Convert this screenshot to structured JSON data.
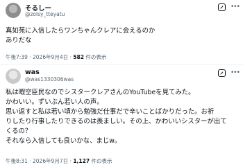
{
  "post1": {
    "display_name": "そるしー",
    "handle": "@zolsy_tteyatu",
    "text_lines": [
      "真如苑に入信したらワンちゃんクレアに会えるのか",
      "ありだな"
    ],
    "time": "午後7:39",
    "date": "2026年9月4日",
    "views_count": "582",
    "views_label": "件の表示",
    "icons": [
      "grok-icon",
      "more-icon"
    ]
  },
  "post2": {
    "display_name": "was",
    "handle": "@was1330306was",
    "text_lines": [
      "私は暇空臣民なのでシスタークレアさんのYouTubeを見てみた。",
      "かわいい。ずいぶん若い人の声。",
      "思い返すと私は若い頃から勉強だ仕事だで辛いことばかりだった。お祈",
      "りしたり行事したりできるのは羨ましい。その上、かわいいシスターが出て",
      "くるの？",
      "それなら入信しても良いかな、まじw。"
    ],
    "time": "午後8:31",
    "date": "2026年9月7日",
    "views_count": "1,127",
    "views_label": "件の表示",
    "icons": [
      "grok-icon",
      "more-icon"
    ]
  },
  "separator": "·"
}
